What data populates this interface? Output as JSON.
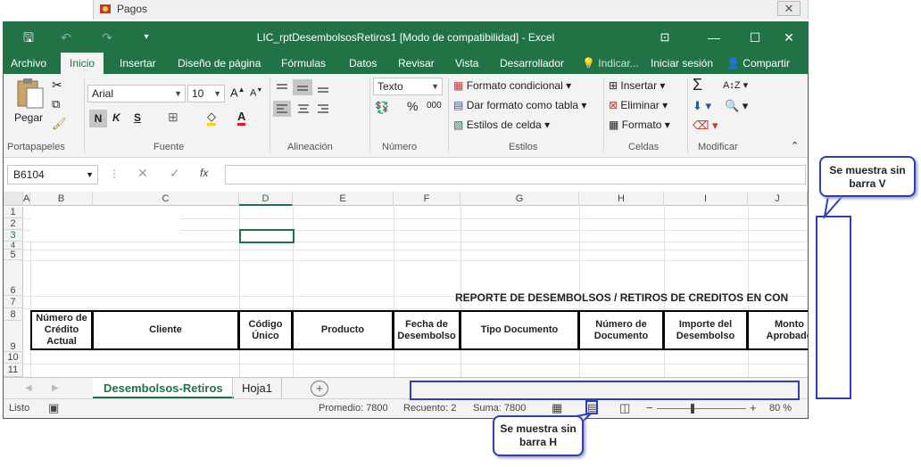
{
  "behind_window": {
    "title": "Pagos",
    "close": "✕"
  },
  "titlebar": {
    "title": "LIC_rptDesembolsosRetiros1  [Modo de compatibilidad] - Excel",
    "save": "🖫",
    "undo": "↶",
    "redo": "↷",
    "customize": "▾",
    "ribbon_display": "⊡",
    "minimize": "—",
    "restore": "☐",
    "close": "✕"
  },
  "menu": {
    "items": [
      "Archivo",
      "Inicio",
      "Insertar",
      "Diseño de página",
      "Fórmulas",
      "Datos",
      "Revisar",
      "Vista",
      "Desarrollador"
    ],
    "tell_me": "Indicar...",
    "signin": "Iniciar sesión",
    "share": "Compartir"
  },
  "ribbon": {
    "clipboard": {
      "paste": "Pegar",
      "label": "Portapapeles"
    },
    "font": {
      "name": "Arial",
      "size": "10",
      "bold": "N",
      "italic": "K",
      "underline": "S",
      "label": "Fuente"
    },
    "alignment": {
      "label": "Alineación"
    },
    "number": {
      "format": "Texto",
      "percent": "%",
      "thousands": "000",
      "label": "Número"
    },
    "styles": {
      "conditional": "Formato condicional",
      "as_table": "Dar formato como tabla",
      "cell_styles": "Estilos de celda",
      "label": "Estilos"
    },
    "cells": {
      "insert": "Insertar",
      "delete": "Eliminar",
      "format": "Formato",
      "label": "Celdas"
    },
    "editing": {
      "label": "Modificar"
    }
  },
  "formula_bar": {
    "name_box": "B6104",
    "fx": "fx",
    "value": ""
  },
  "columns": [
    "A",
    "B",
    "C",
    "D",
    "E",
    "F",
    "G",
    "H",
    "I",
    "J"
  ],
  "rows": [
    "1",
    "2",
    "3",
    "4",
    "5",
    "6",
    "7",
    "8",
    "9",
    "10",
    "11"
  ],
  "report_title": "REPORTE DE DESEMBOLSOS / RETIROS DE CREDITOS EN CON",
  "table_headers": [
    "Número de Crédito Actual",
    "Cliente",
    "Código Único",
    "Producto",
    "Fecha de Desembolso",
    "Tipo Documento",
    "Número de Documento",
    "Importe del Desembolso",
    "Monto Aprobado"
  ],
  "sheets": {
    "active": "Desembolsos-Retiros",
    "other": "Hoja1",
    "add": "+"
  },
  "status": {
    "ready": "Listo",
    "average": "Promedio: 7800",
    "count": "Recuento: 2",
    "sum": "Suma: 7800",
    "zoom": "80 %",
    "zoom_minus": "−",
    "zoom_plus": "+"
  },
  "callouts": {
    "vertical": "Se muestra sin barra V",
    "horizontal": "Se muestra sin barra H"
  },
  "colors": {
    "excel_green": "#217346",
    "callout_blue": "#2c3fb4"
  }
}
